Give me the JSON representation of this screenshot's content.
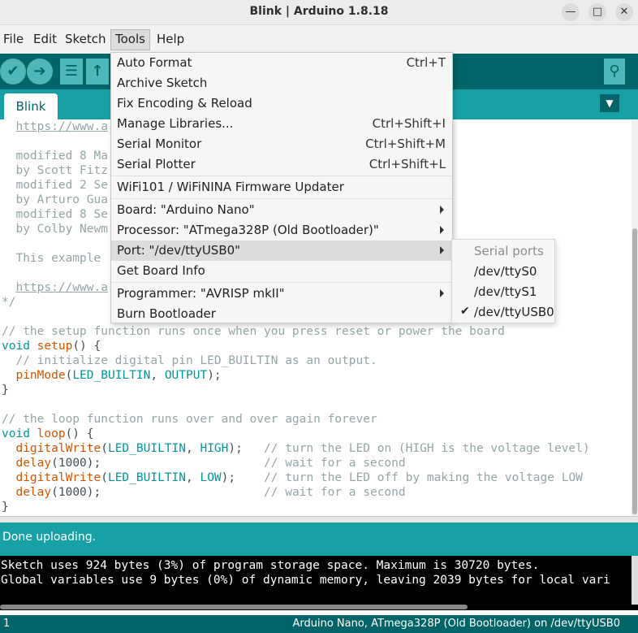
{
  "window": {
    "title": "Blink | Arduino 1.8.18",
    "minimize_glyph": "—",
    "maximize_glyph": "□",
    "close_glyph": "✕"
  },
  "menubar": [
    "File",
    "Edit",
    "Sketch",
    "Tools",
    "Help"
  ],
  "toolbar": {
    "verify_icon": "✔",
    "upload_icon": "➔",
    "new_icon": "☰",
    "open_icon": "↑",
    "serial_monitor_icon": "⚲",
    "icons": [
      "check-icon",
      "arrow-right-icon",
      "new-file-icon",
      "open-icon",
      "serial-monitor-icon"
    ]
  },
  "tab": {
    "name": "Blink",
    "menu_glyph": "▼"
  },
  "code": {
    "lines": [
      [
        {
          "t": "  ",
          "c": ""
        },
        {
          "t": "https://www.a",
          "c": "c-link"
        }
      ],
      [
        {
          "t": "",
          "c": ""
        }
      ],
      [
        {
          "t": "  modified 8 Ma",
          "c": "c-cmt"
        }
      ],
      [
        {
          "t": "  by Scott Fitz",
          "c": "c-cmt"
        }
      ],
      [
        {
          "t": "  modified 2 Se",
          "c": "c-cmt"
        }
      ],
      [
        {
          "t": "  by Arturo Gua",
          "c": "c-cmt"
        }
      ],
      [
        {
          "t": "  modified 8 Se",
          "c": "c-cmt"
        }
      ],
      [
        {
          "t": "  by Colby Newm",
          "c": "c-cmt"
        }
      ],
      [
        {
          "t": "",
          "c": ""
        }
      ],
      [
        {
          "t": "  This example ",
          "c": "c-cmt"
        }
      ],
      [
        {
          "t": "",
          "c": ""
        }
      ],
      [
        {
          "t": "  ",
          "c": ""
        },
        {
          "t": "https://www.a",
          "c": "c-link"
        }
      ],
      [
        {
          "t": "*/",
          "c": "c-cmt"
        }
      ],
      [
        {
          "t": "",
          "c": ""
        }
      ],
      [
        {
          "t": "// the setup function runs once when you press reset or power the board",
          "c": "c-cmt"
        }
      ],
      [
        {
          "t": "void",
          "c": "c-kw"
        },
        {
          "t": " ",
          "c": ""
        },
        {
          "t": "setup",
          "c": "c-fn"
        },
        {
          "t": "() {",
          "c": ""
        }
      ],
      [
        {
          "t": "  // initialize digital pin LED_BUILTIN as an output.",
          "c": "c-cmt"
        }
      ],
      [
        {
          "t": "  ",
          "c": ""
        },
        {
          "t": "pinMode",
          "c": "c-fn"
        },
        {
          "t": "(",
          "c": ""
        },
        {
          "t": "LED_BUILTIN",
          "c": "c-const"
        },
        {
          "t": ", ",
          "c": ""
        },
        {
          "t": "OUTPUT",
          "c": "c-const"
        },
        {
          "t": ");",
          "c": ""
        }
      ],
      [
        {
          "t": "}",
          "c": ""
        }
      ],
      [
        {
          "t": "",
          "c": ""
        }
      ],
      [
        {
          "t": "// the loop function runs over and over again forever",
          "c": "c-cmt"
        }
      ],
      [
        {
          "t": "void",
          "c": "c-kw"
        },
        {
          "t": " ",
          "c": ""
        },
        {
          "t": "loop",
          "c": "c-fn"
        },
        {
          "t": "() {",
          "c": ""
        }
      ],
      [
        {
          "t": "  ",
          "c": ""
        },
        {
          "t": "digitalWrite",
          "c": "c-fn"
        },
        {
          "t": "(",
          "c": ""
        },
        {
          "t": "LED_BUILTIN",
          "c": "c-const"
        },
        {
          "t": ", ",
          "c": ""
        },
        {
          "t": "HIGH",
          "c": "c-const"
        },
        {
          "t": ");   ",
          "c": ""
        },
        {
          "t": "// turn the LED on (HIGH is the voltage level)",
          "c": "c-cmt"
        }
      ],
      [
        {
          "t": "  ",
          "c": ""
        },
        {
          "t": "delay",
          "c": "c-fn"
        },
        {
          "t": "(1000);                       ",
          "c": ""
        },
        {
          "t": "// wait for a second",
          "c": "c-cmt"
        }
      ],
      [
        {
          "t": "  ",
          "c": ""
        },
        {
          "t": "digitalWrite",
          "c": "c-fn"
        },
        {
          "t": "(",
          "c": ""
        },
        {
          "t": "LED_BUILTIN",
          "c": "c-const"
        },
        {
          "t": ", ",
          "c": ""
        },
        {
          "t": "LOW",
          "c": "c-const"
        },
        {
          "t": ");    ",
          "c": ""
        },
        {
          "t": "// turn the LED off by making the voltage LOW",
          "c": "c-cmt"
        }
      ],
      [
        {
          "t": "  ",
          "c": ""
        },
        {
          "t": "delay",
          "c": "c-fn"
        },
        {
          "t": "(1000);                       ",
          "c": ""
        },
        {
          "t": "// wait for a second",
          "c": "c-cmt"
        }
      ],
      [
        {
          "t": "}",
          "c": ""
        }
      ]
    ]
  },
  "tools_menu": {
    "items": [
      {
        "label": "Auto Format",
        "shortcut": "Ctrl+T"
      },
      {
        "label": "Archive Sketch",
        "shortcut": ""
      },
      {
        "label": "Fix Encoding & Reload",
        "shortcut": ""
      },
      {
        "label": "Manage Libraries...",
        "shortcut": "Ctrl+Shift+I"
      },
      {
        "label": "Serial Monitor",
        "shortcut": "Ctrl+Shift+M"
      },
      {
        "label": "Serial Plotter",
        "shortcut": "Ctrl+Shift+L"
      },
      {
        "label": "WiFi101 / WiFiNINA Firmware Updater",
        "shortcut": ""
      },
      {
        "label": "Board: \"Arduino Nano\"",
        "shortcut": "",
        "submenu": true
      },
      {
        "label": "Processor: \"ATmega328P (Old Bootloader)\"",
        "shortcut": "",
        "submenu": true
      },
      {
        "label": "Port: \"/dev/ttyUSB0\"",
        "shortcut": "",
        "submenu": true,
        "highlighted": true
      },
      {
        "label": "Get Board Info",
        "shortcut": ""
      },
      {
        "label": "Programmer: \"AVRISP mkII\"",
        "shortcut": "",
        "submenu": true
      },
      {
        "label": "Burn Bootloader",
        "shortcut": ""
      }
    ]
  },
  "port_submenu": {
    "header": "Serial ports",
    "ports": [
      "/dev/ttyS0",
      "/dev/ttyS1",
      "/dev/ttyUSB0"
    ],
    "selected": "/dev/ttyUSB0",
    "check_glyph": "✔"
  },
  "status": {
    "message": "Done uploading."
  },
  "console": {
    "lines": [
      "Sketch uses 924 bytes (3%) of program storage space. Maximum is 30720 bytes.",
      "Global variables use 9 bytes (0%) of dynamic memory, leaving 2039 bytes for local vari"
    ]
  },
  "footer": {
    "line_number": "1",
    "board_info": "Arduino Nano, ATmega328P (Old Bootloader) on /dev/ttyUSB0"
  },
  "colors": {
    "toolbar": "#006468",
    "tabbar": "#17a1a5",
    "keyword": "#00979c",
    "function": "#d35400",
    "comment": "#95a5a6"
  }
}
